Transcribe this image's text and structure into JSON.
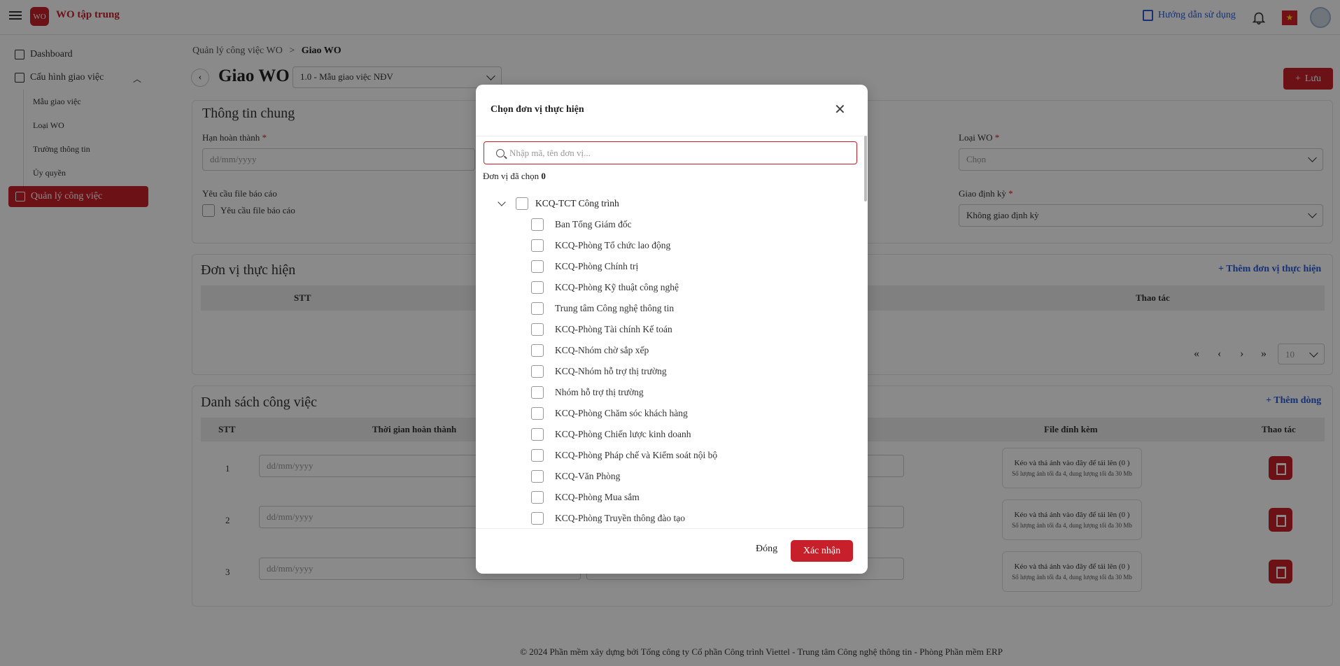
{
  "app": {
    "title": "WO tập trung",
    "logo_text": "WO"
  },
  "topbar": {
    "guide_label": "Hướng dẫn sử dụng",
    "flag_symbol": "★"
  },
  "sidebar": {
    "dashboard": "Dashboard",
    "config": "Cấu hình giao việc",
    "subitems": [
      "Mẫu giao việc",
      "Loại WO",
      "Trường thông tin",
      "Ủy quyền"
    ],
    "active": "Quản lý công việc"
  },
  "breadcrumb": {
    "parent": "Quản lý công việc WO",
    "separator": ">",
    "current": "Giao WO"
  },
  "page": {
    "title": "Giao WO",
    "template_value": "1.0 - Mẫu giao việc NĐV",
    "save_label": "Lưu",
    "back_symbol": "‹"
  },
  "general": {
    "title": "Thông tin chung",
    "deadline_label": "Hạn hoàn thành",
    "deadline_placeholder": "dd/mm/yyyy",
    "wo_type_label": "Loại WO",
    "wo_type_placeholder": "Chọn",
    "report_req_label": "Yêu cầu file báo cáo",
    "report_req_checkbox": "Yêu cầu file báo cáo",
    "periodic_label": "Giao định kỳ",
    "periodic_value": "Không giao định kỳ",
    "required_mark": "*"
  },
  "units": {
    "title": "Đơn vị thực hiện",
    "add_label": "Thêm đơn vị thực hiện",
    "col_stt": "STT",
    "col_action": "Thao tác",
    "page_size": "10"
  },
  "tasks": {
    "title": "Danh sách công việc",
    "add_label": "Thêm dòng",
    "col_stt": "STT",
    "col_time": "Thời gian hoàn thành",
    "col_file": "File đính kèm",
    "col_action": "Thao tác",
    "date_placeholder": "dd/mm/yyyy",
    "drop_text": "Kéo và thả ảnh vào đây để tải lên (0 )",
    "drop_hint": "Số lượng ảnh tối đa 4, dung lượng tối đa 30 Mb",
    "rows": [
      "1",
      "2",
      "3"
    ]
  },
  "footer": "© 2024 Phần mềm xây dựng bởi Tổng công ty Cổ phần Công trình Viettel - Trung tâm Công nghệ thông tin - Phòng Phần mềm ERP",
  "modal": {
    "title": "Chọn đơn vị thực hiện",
    "close_symbol": "✕",
    "search_placeholder": "Nhập mã, tên đơn vị...",
    "selected_label": "Đơn vị đã chọn",
    "selected_count": "0",
    "root": "KCQ-TCT Công trình",
    "items": [
      "Ban Tổng Giám đốc",
      "KCQ-Phòng Tổ chức lao động",
      "KCQ-Phòng Chính trị",
      "KCQ-Phòng Kỹ thuật công nghệ",
      "Trung tâm Công nghệ thông tin",
      "KCQ-Phòng Tài chính Kế toán",
      "KCQ-Nhóm chờ sắp xếp",
      "KCQ-Nhóm hỗ trợ thị trường",
      "Nhóm hỗ trợ thị trường",
      "KCQ-Phòng Chăm sóc khách hàng",
      "KCQ-Phòng Chiến lược kinh doanh",
      "KCQ-Phòng Pháp chế và Kiểm soát nội bộ",
      "KCQ-Văn Phòng",
      "KCQ-Phòng Mua sắm",
      "KCQ-Phòng Truyền thông đào tạo"
    ],
    "cancel_label": "Đóng",
    "confirm_label": "Xác nhận"
  },
  "colors": {
    "accent": "#c8202a",
    "link": "#2a5bd7"
  }
}
